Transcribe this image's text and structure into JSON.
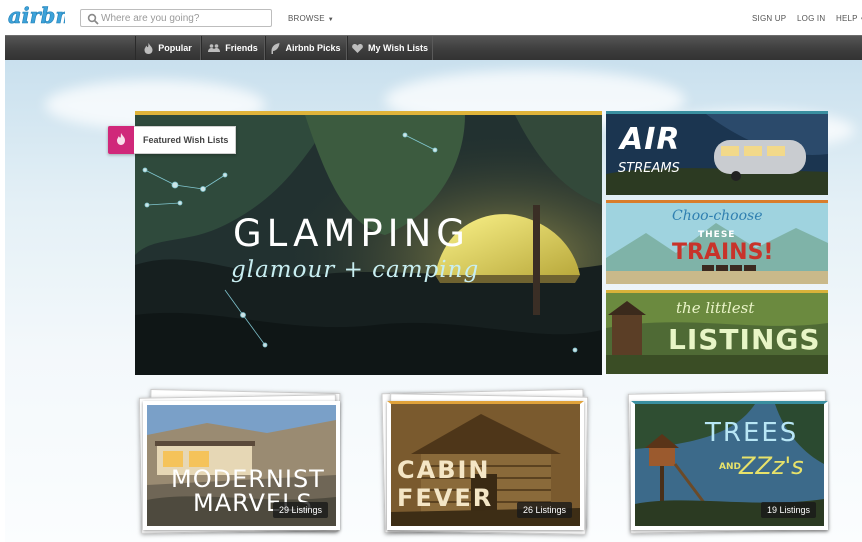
{
  "header": {
    "logo": "airbnb",
    "search_placeholder": "Where are you going?",
    "browse_label": "BROWSE",
    "nav": {
      "sign_up": "SIGN UP",
      "log_in": "LOG IN",
      "help": "HELP"
    }
  },
  "subnav": {
    "tabs": [
      {
        "label": "Popular",
        "icon": "flame-icon"
      },
      {
        "label": "Friends",
        "icon": "people-icon"
      },
      {
        "label": "Airbnb Picks",
        "icon": "leaf-icon"
      },
      {
        "label": "My Wish Lists",
        "icon": "heart-icon"
      }
    ]
  },
  "featured": {
    "badge_label": "Featured Wish Lists",
    "hero": {
      "title": "GLAMPING",
      "subtitle": "glamour + camping"
    },
    "side_tiles": [
      {
        "line1": "AIR",
        "line2": "STREAMS",
        "accent": "#3a8fa0"
      },
      {
        "line1": "Choo-choose",
        "line2": "THESE",
        "line3": "TRAINS!",
        "accent": "#d97d2b"
      },
      {
        "line1": "the littlest",
        "line2": "LISTINGS",
        "accent": "#d9b23a"
      }
    ]
  },
  "collections": [
    {
      "line1": "MODERNIST",
      "line2": "MARVELS",
      "listings": "29 Listings"
    },
    {
      "line1": "CABIN FEVER",
      "listings": "26 Listings"
    },
    {
      "line1": "TREES",
      "line2": "AND",
      "line3": "ZZz's",
      "listings": "19 Listings"
    }
  ],
  "colors": {
    "brand": "#ff5a5f",
    "logo_blue": "#3da2d9",
    "featured_ribbon": "#d0287a",
    "hero_accent": "#e0b43a"
  }
}
